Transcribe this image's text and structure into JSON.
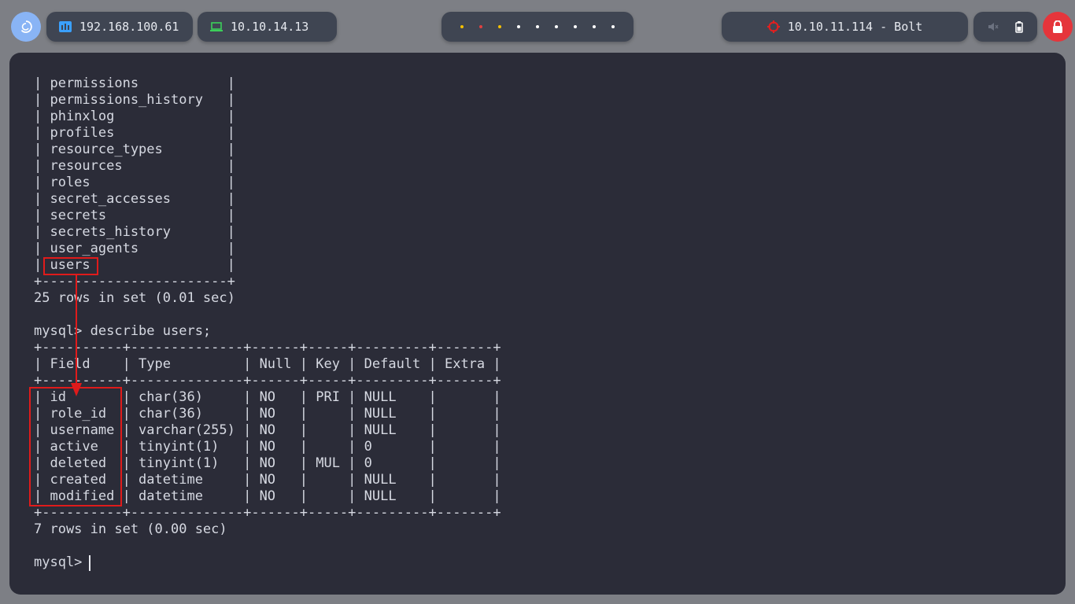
{
  "topbar": {
    "host_ip": "192.168.100.61",
    "vpn_ip": "10.10.14.13",
    "target": "10.10.11.114 - Bolt",
    "workspace_dot_colors": [
      "#f5c000",
      "#e04040",
      "#f5c000",
      "#ffffff",
      "#ffffff",
      "#ffffff",
      "#ffffff",
      "#ffffff",
      "#ffffff",
      "#ffffff"
    ],
    "icons": {
      "distro": "debian-swirl-icon",
      "host": "network-icon",
      "vpn": "laptop-icon",
      "target": "crosshair-icon",
      "mute": "speaker-muted-icon",
      "battery": "battery-icon",
      "lock": "lock-icon"
    },
    "colors": {
      "accent": "#89b4f5",
      "lock": "#e5353b",
      "target_icon": "#e02020",
      "vpn_icon": "#3ccf5a",
      "host_icon": "#3aa0ff"
    }
  },
  "terminal": {
    "lines": [
      "| permissions           |",
      "| permissions_history   |",
      "| phinxlog              |",
      "| profiles              |",
      "| resource_types        |",
      "| resources             |",
      "| roles                 |",
      "| secret_accesses       |",
      "| secrets               |",
      "| secrets_history       |",
      "| user_agents           |",
      "| users                 |",
      "+-----------------------+",
      "25 rows in set (0.01 sec)",
      "",
      "mysql> describe users;",
      "+----------+--------------+------+-----+---------+-------+",
      "| Field    | Type         | Null | Key | Default | Extra |",
      "+----------+--------------+------+-----+---------+-------+",
      "| id       | char(36)     | NO   | PRI | NULL    |       |",
      "| role_id  | char(36)     | NO   |     | NULL    |       |",
      "| username | varchar(255) | NO   |     | NULL    |       |",
      "| active   | tinyint(1)   | NO   |     | 0       |       |",
      "| deleted  | tinyint(1)   | NO   | MUL | 0       |       |",
      "| created  | datetime     | NO   |     | NULL    |       |",
      "| modified | datetime     | NO   |     | NULL    |       |",
      "+----------+--------------+------+-----+---------+-------+",
      "7 rows in set (0.00 sec)",
      "",
      "mysql> "
    ],
    "colors": {
      "background": "#2b2c38",
      "text": "#d6d9e2",
      "highlight": "#e01b1b"
    }
  }
}
